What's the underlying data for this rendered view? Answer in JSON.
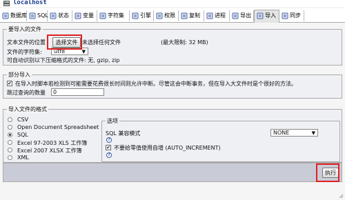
{
  "window": {
    "title": "localhost"
  },
  "tabs": [
    {
      "label": "数据库",
      "icon": "database-icon",
      "active": false
    },
    {
      "label": "SQL",
      "icon": "sql-icon",
      "active": false
    },
    {
      "label": "状态",
      "icon": "status-icon",
      "active": false
    },
    {
      "label": "变量",
      "icon": "variables-icon",
      "active": false
    },
    {
      "label": "字符集",
      "icon": "charset-icon",
      "active": false
    },
    {
      "label": "引擎",
      "icon": "engines-icon",
      "active": false
    },
    {
      "label": "权限",
      "icon": "privileges-icon",
      "active": false
    },
    {
      "label": "复制",
      "icon": "replication-icon",
      "active": false
    },
    {
      "label": "进程",
      "icon": "processes-icon",
      "active": false
    },
    {
      "label": "导出",
      "icon": "export-icon",
      "active": false
    },
    {
      "label": "导入",
      "icon": "import-icon",
      "active": true
    },
    {
      "label": "同步",
      "icon": "sync-icon",
      "active": false
    }
  ],
  "file_section": {
    "legend": "要导入的文件",
    "location_label": "文本文件的位置",
    "choose_button": "选择文件",
    "no_file_text": "未选择任何文件",
    "max_size": "(最大限制: 32 MB)",
    "charset_label": "文件的字符集:",
    "charset_value": "utf8",
    "compression_note": "可自动识别以下压缩格式的文件: 无, gzip, zip"
  },
  "partial_section": {
    "legend": "部分导入",
    "interrupt_text": "在导入时脚本若检测到可能需要花费很长时间则允许中断。尽管这会中断事务，但在导入大文件时是个很好的方法。",
    "interrupt_checked": true,
    "skip_label": "跳过查询的数量",
    "skip_value": "0"
  },
  "format_section": {
    "legend": "导入文件的格式",
    "formats": [
      {
        "label": "CSV",
        "selected": false
      },
      {
        "label": "Open Document Spreadsheet",
        "selected": false
      },
      {
        "label": "SQL",
        "selected": true
      },
      {
        "label": "Excel 97-2003 XLS 工作簿",
        "selected": false
      },
      {
        "label": "Excel 2007 XLSX 工作簿",
        "selected": false
      },
      {
        "label": "XML",
        "selected": false
      }
    ],
    "options_legend": "选项",
    "compat_label": "SQL 兼容模式",
    "compat_value": "NONE",
    "auto_inc_label": "不要给零值使用自增 (AUTO_INCREMENT)",
    "auto_inc_checked": true
  },
  "footer": {
    "execute_button": "执行"
  },
  "colors": {
    "highlight": "#e02020",
    "title_blue": "#1a3a8a"
  }
}
